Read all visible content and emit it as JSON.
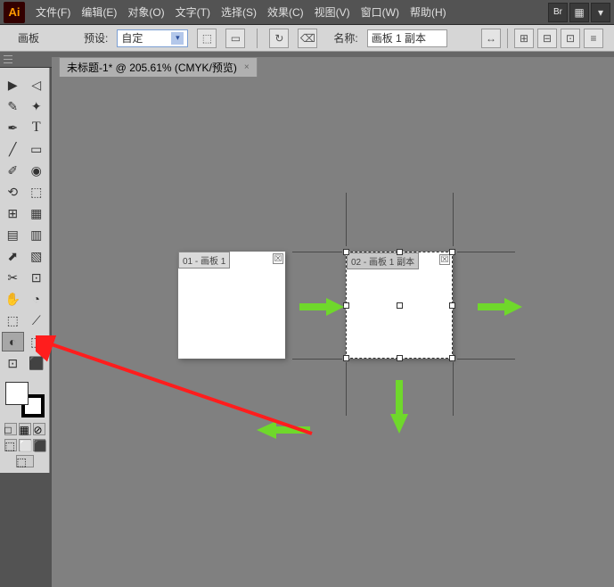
{
  "menubar": {
    "logo": "Ai",
    "items": [
      "文件(F)",
      "编辑(E)",
      "对象(O)",
      "文字(T)",
      "选择(S)",
      "效果(C)",
      "视图(V)",
      "窗口(W)",
      "帮助(H)"
    ],
    "right": [
      "Br",
      "▦",
      "▾"
    ]
  },
  "optionbar": {
    "tool_label": "画板",
    "preset_label": "预设:",
    "preset_value": "自定",
    "name_label": "名称:",
    "name_value": "画板 1 副本",
    "orient_icons": [
      "⬚",
      "▭",
      "↻"
    ],
    "right_icons": [
      "↔",
      "⊞",
      "⊟",
      "⊡",
      "≡"
    ]
  },
  "tab": {
    "title": "未标题-1* @ 205.61% (CMYK/预览)",
    "close": "×"
  },
  "artboards": {
    "ab1_label": "01 - 画板 1",
    "ab2_label": "02 - 画板 1 副本"
  },
  "tools": [
    [
      "▶",
      "◁"
    ],
    [
      "✎",
      "✦"
    ],
    [
      "✒",
      "T"
    ],
    [
      "╱",
      "▭"
    ],
    [
      "✐",
      "◉"
    ],
    [
      "⟲",
      "⬚"
    ],
    [
      "⊞",
      "▦"
    ],
    [
      "▤",
      "▥"
    ],
    [
      "⬈",
      "▧"
    ],
    [
      "✂",
      "⊡"
    ],
    [
      "✋",
      "◔"
    ],
    [
      "⬚",
      "⟋"
    ],
    [
      "◐",
      "⬚"
    ],
    [
      "⊡",
      "⬛"
    ]
  ],
  "swatch_row": [
    "□",
    "▦",
    "⊘"
  ],
  "screen_row": [
    "⬚",
    "⬜",
    "⬛"
  ],
  "chart_data": null
}
